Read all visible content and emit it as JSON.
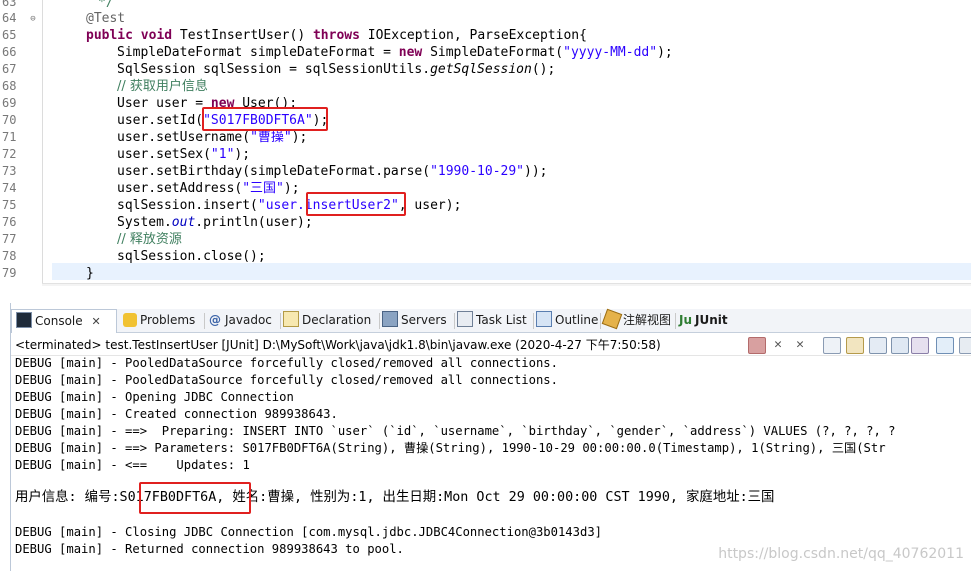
{
  "editor": {
    "line_numbers": [
      "63",
      "64",
      "65",
      "66",
      "67",
      "68",
      "69",
      "70",
      "71",
      "72",
      "73",
      "74",
      "75",
      "76",
      "77",
      "78",
      "79"
    ],
    "top_fragment": "*/",
    "annotation": "@Test",
    "method_sig": {
      "mod": "public void",
      "name": " TestInsertUser() ",
      "throws_kw": "throws",
      "rest": " IOException, ParseException{"
    },
    "line66": {
      "a": "SimpleDateFormat simpleDateFormat = ",
      "new_kw": "new",
      "b": " SimpleDateFormat(",
      "s": "\"yyyy-MM-dd\"",
      "c": ");"
    },
    "line67": {
      "a": "SqlSession sqlSession = sqlSessionUtils.",
      "m": "getSqlSession",
      "c": "();"
    },
    "comment68": "// 获取用户信息",
    "line69": {
      "a": "User user = ",
      "new_kw": "new",
      "b": " User();"
    },
    "line70": {
      "a": "user.setId(",
      "s": "\"S017FB0DFT6A\"",
      "c": ");"
    },
    "line71": {
      "a": "user.setUsername(",
      "s": "\"曹操\"",
      "c": ");"
    },
    "line72": {
      "a": "user.setSex(",
      "s": "\"1\"",
      "c": ");"
    },
    "line73": {
      "a": "user.setBirthday(simpleDateFormat.parse(",
      "s": "\"1990-10-29\"",
      "c": "));"
    },
    "line74": {
      "a": "user.setAddress(",
      "s": "\"三国\"",
      "c": ");"
    },
    "line75": {
      "a": "sqlSession.insert(",
      "s": "\"user.insertUser2\"",
      "c": ", user);"
    },
    "line76": {
      "a": "System.",
      "f": "out",
      "c": ".println(user);"
    },
    "comment77": "// 释放资源",
    "line78": "sqlSession.close();",
    "line79": "}",
    "scroll_glyph": "<"
  },
  "tabs": {
    "console": "Console",
    "console_close": "✕",
    "problems": "Problems",
    "javadoc": "Javadoc",
    "declaration": "Declaration",
    "servers": "Servers",
    "tasklist": "Task List",
    "outline": "Outline",
    "annotations": "注解视图",
    "junit": "JUnit"
  },
  "console": {
    "terminated": "<terminated> test.TestInsertUser [JUnit] D:\\MySoft\\Work\\java\\jdk1.8\\bin\\javaw.exe (2020-4-27 下午7:50:58)",
    "lines": [
      "DEBUG [main] - PooledDataSource forcefully closed/removed all connections.",
      "DEBUG [main] - PooledDataSource forcefully closed/removed all connections.",
      "DEBUG [main] - Opening JDBC Connection",
      "DEBUG [main] - Created connection 989938643.",
      "DEBUG [main] - ==>  Preparing: INSERT INTO `user` (`id`, `username`, `birthday`, `gender`, `address`) VALUES (?, ?, ?, ?",
      "DEBUG [main] - ==> Parameters: S017FB0DFT6A(String), 曹操(String), 1990-10-29 00:00:00.0(Timestamp), 1(String), 三国(Str",
      "DEBUG [main] - <==    Updates: 1"
    ],
    "user_line": "用户信息: 编号:S017FB0DFT6A, 姓名:曹操, 性别为:1, 出生日期:Mon Oct 29 00:00:00 CST 1990, 家庭地址:三国",
    "tail_lines": [
      "DEBUG [main] - Closing JDBC Connection [com.mysql.jdbc.JDBC4Connection@3b0143d3]",
      "DEBUG [main] - Returned connection 989938643 to pool."
    ],
    "watermark": "https://blog.csdn.net/qq_40762011"
  },
  "colors": {
    "keyword": "#7f0055",
    "string": "#2a00ff",
    "comment": "#3f7f5f",
    "highlight_box": "#e0201f",
    "current_line": "#e8f2fe"
  }
}
